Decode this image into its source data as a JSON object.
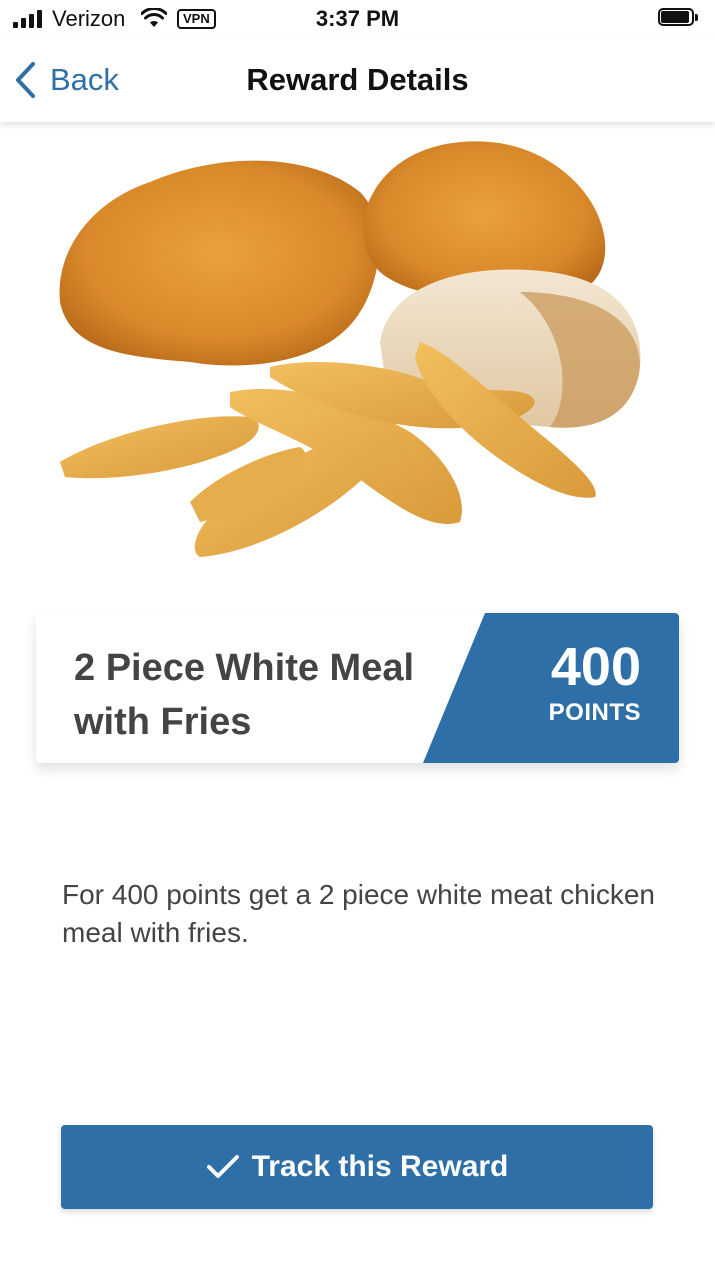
{
  "status_bar": {
    "carrier": "Verizon",
    "vpn": "VPN",
    "time": "3:37 PM",
    "icons": [
      "signal-icon",
      "wifi-icon",
      "battery-icon"
    ]
  },
  "nav": {
    "back_label": "Back",
    "title": "Reward Details"
  },
  "reward": {
    "image": "fried-chicken-and-fries-photo",
    "title": "2 Piece White Meal with Fries",
    "points": "400",
    "points_label": "POINTS",
    "description": "For 400 points get a 2 piece white meat chicken meal with fries."
  },
  "actions": {
    "track_label": "Track this Reward"
  },
  "colors": {
    "accent": "#2f6fa7",
    "text": "#444444"
  }
}
